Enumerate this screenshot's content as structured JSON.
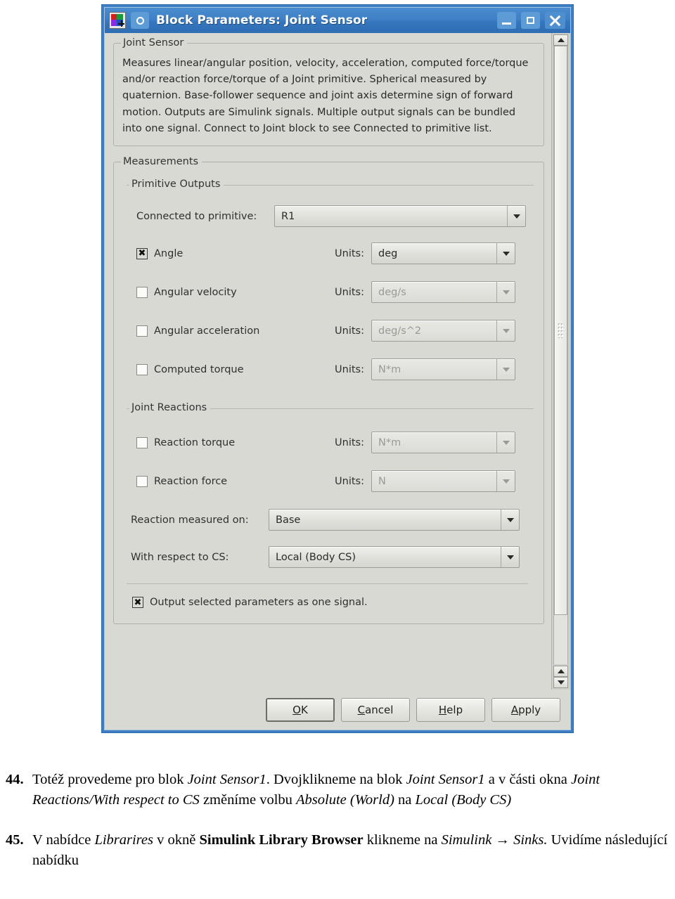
{
  "window": {
    "title": "Block Parameters: Joint Sensor",
    "app_icon": "matlab-icon",
    "doc_icon": "circle-icon",
    "minimize_label": "_",
    "maximize_label": "□",
    "close_label": "×",
    "accent_color": "#3c7fc4",
    "face_color": "#d9d9d4"
  },
  "description_group": {
    "title": "Joint Sensor",
    "text": "Measures linear/angular position, velocity, acceleration, computed force/torque and/or reaction force/torque of a Joint primitive. Spherical measured by quaternion. Base-follower sequence and joint axis determine sign of forward motion. Outputs are Simulink signals. Multiple output signals can be bundled into one signal. Connect to Joint block to see Connected to primitive list."
  },
  "measurements": {
    "title": "Measurements",
    "primitive_outputs": {
      "title": "Primitive Outputs",
      "connected_to_label": "Connected to primitive:",
      "connected_to_value": "R1",
      "units_label": "Units:",
      "rows": [
        {
          "label": "Angle",
          "checked": true,
          "units": "deg",
          "enabled": true
        },
        {
          "label": "Angular velocity",
          "checked": false,
          "units": "deg/s",
          "enabled": false
        },
        {
          "label": "Angular acceleration",
          "checked": false,
          "units": "deg/s^2",
          "enabled": false
        },
        {
          "label": "Computed torque",
          "checked": false,
          "units": "N*m",
          "enabled": false
        }
      ]
    },
    "joint_reactions": {
      "title": "Joint Reactions",
      "units_label": "Units:",
      "rows": [
        {
          "label": "Reaction torque",
          "checked": false,
          "units": "N*m",
          "enabled": false
        },
        {
          "label": "Reaction force",
          "checked": false,
          "units": "N",
          "enabled": false
        }
      ],
      "measured_on_label": "Reaction measured on:",
      "measured_on_value": "Base",
      "wrt_cs_label": "With respect to CS:",
      "wrt_cs_value": "Local (Body CS)"
    },
    "output_one_signal": {
      "label": "Output selected parameters as one signal.",
      "checked": true
    },
    "checkbox_mark": "✖"
  },
  "buttons": {
    "ok": {
      "accel": "O",
      "rest": "K"
    },
    "cancel": {
      "accel": "C",
      "rest": "ancel"
    },
    "help": {
      "accel": "H",
      "rest": "elp"
    },
    "apply": {
      "accel": "A",
      "rest": "pply"
    }
  },
  "captions": [
    {
      "number": "44.",
      "html": "Totéž provedeme pro blok <i>Joint Sensor1</i>. Dvojklikneme na blok <i>Joint Sensor1</i> a v části okna <i>Joint Reactions/With respect to CS</i> změníme volbu <i>Absolute (World)</i> na <i>Local (Body CS)</i>"
    },
    {
      "number": "45.",
      "html": "V nabídce <i>Librarires</i> v okně <b>Simulink Library Browser</b> klikneme na <i>Simulink → Sinks.</i> Uvidíme následující nabídku"
    }
  ]
}
